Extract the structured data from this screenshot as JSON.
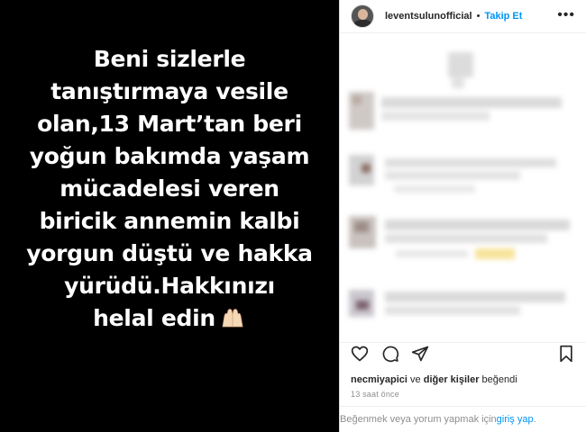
{
  "post": {
    "lines": [
      "Beni sizlerle",
      "tanıştırmaya vesile",
      "olan,13 Mart’tan beri",
      "yoğun bakımda yaşam",
      "mücadelesi veren",
      "biricik annemin kalbi",
      "yorgun düştü ve hakka",
      "yürüdü.Hakkınızı",
      "helal edin"
    ],
    "emoji_icon": "praying-hands-icon"
  },
  "header": {
    "username": "leventsulunofficial",
    "separator": "•",
    "follow_label": "Takip Et",
    "more_label": "•••"
  },
  "engagement": {
    "liker": "necmiyapici",
    "connector": " ve ",
    "others": "diğer kişiler",
    "suffix": " beğendi",
    "time": "13 saat önce"
  },
  "login": {
    "prefix": "Beğenmek veya yorum yapmak için ",
    "link": "giriş yap",
    "suffix": "."
  },
  "colors": {
    "accent": "#0095f6",
    "text": "#262626",
    "muted": "#8e8e8e",
    "post_bg": "#000000"
  }
}
